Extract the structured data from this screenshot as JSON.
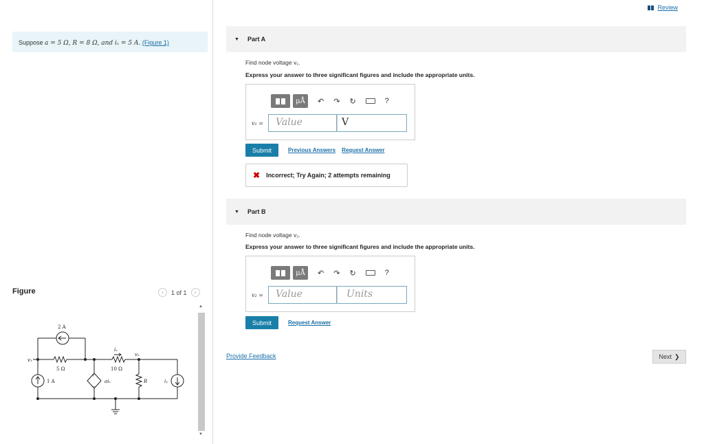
{
  "review": {
    "label": "Review"
  },
  "problem": {
    "prefix": "Suppose",
    "statement": "a = 5 Ω, R = 8 Ω, and iₓ = 5 A.",
    "figure_link": "(Figure 1)"
  },
  "figure": {
    "heading": "Figure",
    "pager": "1 of 1",
    "labels": {
      "v1": "v₁",
      "v2": "v₂",
      "src2a": "2 A",
      "src1a": "1 A",
      "r5": "5 Ω",
      "r10": "10 Ω",
      "ix": "iₓ",
      "aix": "aiₓ",
      "plus": "+",
      "minus": "−",
      "R": "R",
      "iy": "iᵧ"
    }
  },
  "partA": {
    "title": "Part A",
    "question": "Find node voltage v₁.",
    "instruction": "Express your answer to three significant figures and include the appropriate units.",
    "var_label": "v₁ =",
    "value_placeholder": "Value",
    "unit_value": "V",
    "submit": "Submit",
    "previous_answers": "Previous Answers",
    "request_answer": "Request Answer",
    "feedback": "Incorrect; Try Again; 2 attempts remaining"
  },
  "partB": {
    "title": "Part B",
    "question": "Find node voltage v₂.",
    "instruction": "Express your answer to three significant figures and include the appropriate units.",
    "var_label": "v₂ =",
    "value_placeholder": "Value",
    "unit_placeholder": "Units",
    "submit": "Submit",
    "request_answer": "Request Answer"
  },
  "toolbar": {
    "units_label": "μÅ",
    "help": "?"
  },
  "footer": {
    "provide_feedback": "Provide Feedback",
    "next": "Next"
  }
}
